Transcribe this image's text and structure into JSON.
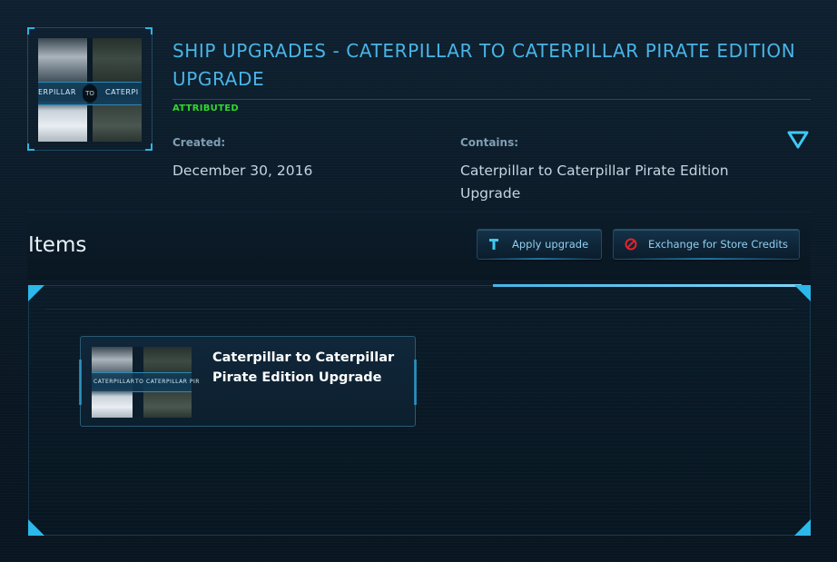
{
  "pledge": {
    "title": "SHIP UPGRADES - CATERPILLAR TO CATERPILLAR PIRATE EDITION UPGRADE",
    "status": "ATTRIBUTED",
    "status_color": "#2fd92a",
    "created_label": "Created:",
    "created_value": "December 30, 2016",
    "contains_label": "Contains:",
    "contains_value": "Caterpillar to Caterpillar Pirate Edition Upgrade",
    "expand_icon": "triangle-down-icon",
    "thumbnail": {
      "left_label": "ERPILLAR",
      "to_label": "TO",
      "right_label": "CATERPI"
    }
  },
  "items_section": {
    "heading": "Items",
    "apply_button": {
      "label": "Apply upgrade",
      "icon": "wrench-icon"
    },
    "exchange_button": {
      "label": "Exchange for Store Credits",
      "icon": "no-entry-icon"
    }
  },
  "items": [
    {
      "name": "Caterpillar to Caterpillar Pirate Edition Upgrade",
      "thumb_left_label": "CATERPILLAR",
      "thumb_to_label": "TO",
      "thumb_right_label": "CATERPILLAR PIR"
    }
  ],
  "colors": {
    "accent": "#49b4e6",
    "background": "#0b1a27",
    "corner_accent": "#2bb8ea",
    "exchange_icon": "#e0242a"
  }
}
